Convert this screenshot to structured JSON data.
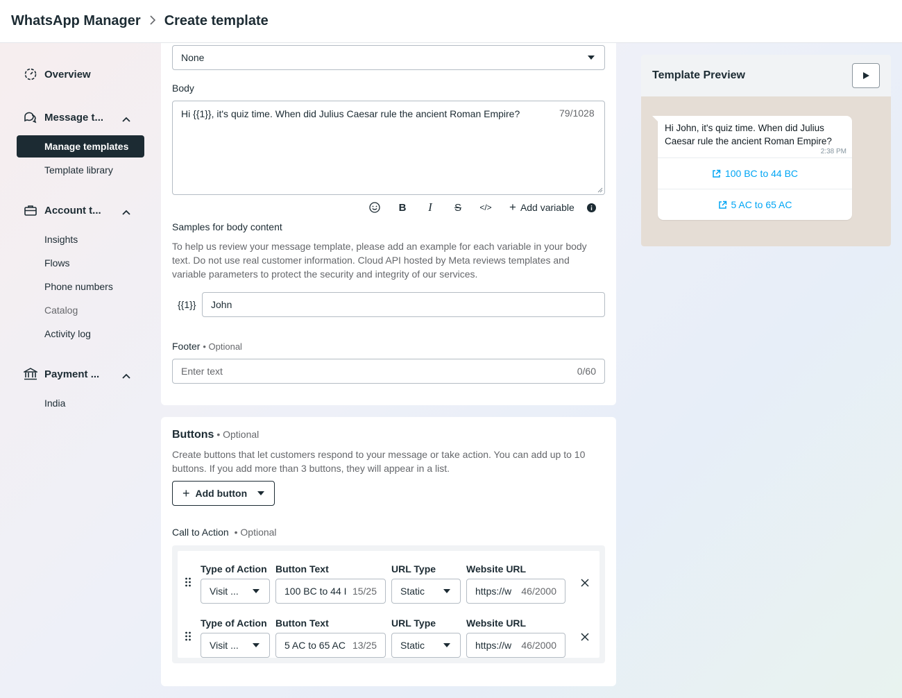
{
  "header": {
    "app_title": "WhatsApp Manager",
    "separator": ">",
    "page_title": "Create template"
  },
  "sidebar": {
    "overview": "Overview",
    "message_templates": "Message t...",
    "manage_templates": "Manage templates",
    "template_library": "Template library",
    "account_tools": "Account t...",
    "insights": "Insights",
    "flows": "Flows",
    "phone_numbers": "Phone numbers",
    "catalog": "Catalog",
    "activity_log": "Activity log",
    "payment_methods": "Payment ...",
    "india": "India"
  },
  "header_select": {
    "value": "None"
  },
  "body": {
    "label": "Body",
    "text": "Hi {{1}}, it's quiz time. When did Julius Caesar rule the ancient Roman Empire?",
    "counter": "79/1028",
    "add_variable": "Add variable"
  },
  "samples": {
    "label": "Samples for body content",
    "help": "To help us review your message template, please add an example for each variable in your body text. Do not use real customer information. Cloud API hosted by Meta reviews templates and variable parameters to protect the security and integrity of our services.",
    "var_label": "{{1}}",
    "var_value": "John"
  },
  "footer": {
    "label": "Footer",
    "optional": "• Optional",
    "placeholder": "Enter text",
    "counter": "0/60"
  },
  "buttons": {
    "title": "Buttons",
    "optional": "• Optional",
    "help": "Create buttons that let customers respond to your message or take action. You can add up to 10 buttons. If you add more than 3 buttons, they will appear in a list.",
    "add_button": "Add button"
  },
  "cta": {
    "label": "Call to Action",
    "optional": "• Optional",
    "headers": {
      "type": "Type of Action",
      "text": "Button Text",
      "url_type": "URL Type",
      "website": "Website URL"
    },
    "rows": [
      {
        "type": "Visit ...",
        "text": "100 BC to 44 I",
        "text_count": "15/25",
        "url_type": "Static",
        "url": "https://w",
        "url_count": "46/2000"
      },
      {
        "type": "Visit ...",
        "text": "5 AC to 65 AC",
        "text_count": "13/25",
        "url_type": "Static",
        "url": "https://w",
        "url_count": "46/2000"
      }
    ]
  },
  "preview": {
    "title": "Template Preview",
    "message": "Hi John, it's quiz time. When did Julius Caesar rule the ancient Roman Empire?",
    "time": "2:38 PM",
    "buttons": [
      "100 BC to 44 BC",
      "5 AC to 65 AC"
    ]
  },
  "colors": {
    "nav_active": "#1c2b33",
    "link": "#00a5f4",
    "chat_bg": "#e5ddd5"
  }
}
